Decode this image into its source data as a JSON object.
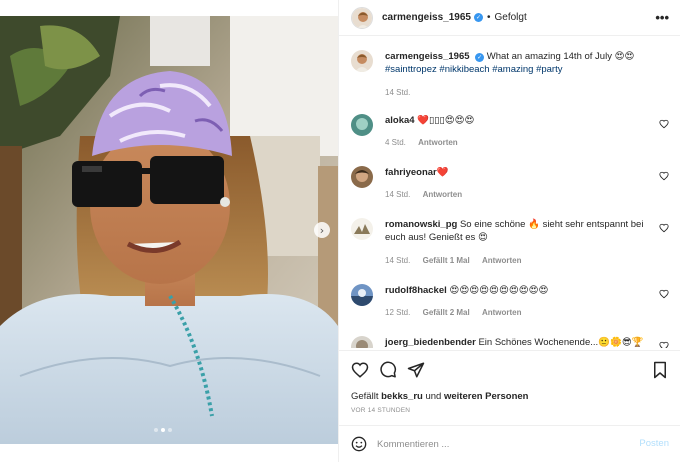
{
  "post": {
    "author": "carmengeiss_1965",
    "follow_state": "Gefolgt",
    "separator": "•",
    "caption": {
      "text": "What an amazing 14th of July 😍😍",
      "hashtags": [
        "#sainttropez",
        "#nikkibeach",
        "#amazing",
        "#party"
      ],
      "time": "14 Std."
    },
    "icons": {
      "more": "more-options-icon",
      "verified": "verified-badge-icon",
      "next": "chevron-right-icon"
    }
  },
  "comments": [
    {
      "user": "aloka4",
      "text": "❤️▯▯▯😍😍😍",
      "time": "4 Std.",
      "likes": "",
      "reply": "Antworten"
    },
    {
      "user": "fahriyeonar",
      "text": "❤️",
      "time": "14 Std.",
      "likes": "",
      "reply": "Antworten"
    },
    {
      "user": "romanowski_pg",
      "text": "So eine schöne 🔥 sieht sehr entspannt bei euch aus! Genießt es 😍",
      "time": "14 Std.",
      "likes": "Gefällt 1 Mal",
      "reply": "Antworten"
    },
    {
      "user": "rudolf8hackel",
      "text": "😍😍😍😍😍😍😍😍😍😍",
      "time": "12 Std.",
      "likes": "Gefällt 2 Mal",
      "reply": "Antworten"
    },
    {
      "user": "joerg_biedenbender",
      "text": "Ein Schönes Wochenende...🙂🌼😎🏆",
      "time": "",
      "likes": "",
      "reply": ""
    }
  ],
  "actions": {
    "likes_prefix": "Gefällt",
    "likes_user": "bekks_ru",
    "likes_conj": "und",
    "likes_suffix": "weiteren Personen",
    "date": "VOR 14 STUNDEN"
  },
  "add_comment": {
    "placeholder": "Kommentieren ...",
    "post_label": "Posten"
  },
  "carousel": {
    "slide_count": 3,
    "active_index": 1
  },
  "colors": {
    "verified": "#3897f0",
    "hashtag": "#00376b",
    "muted": "#8e8e8e",
    "post_disabled": "#b2dffc"
  }
}
